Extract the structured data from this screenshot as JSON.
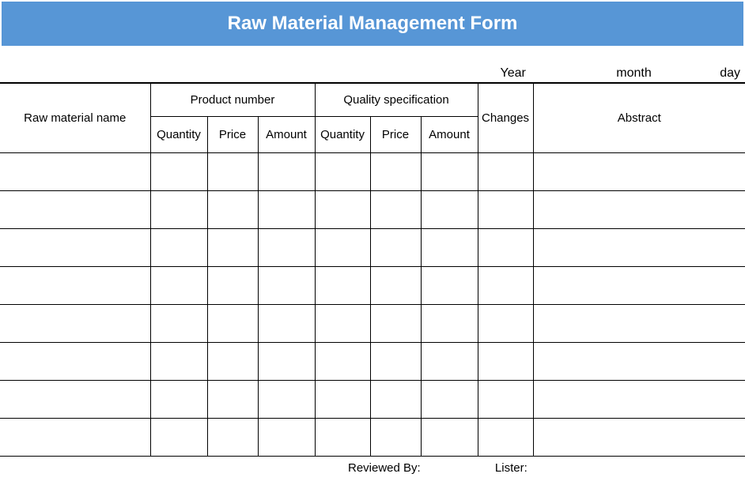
{
  "title": "Raw Material Management Form",
  "date": {
    "year_label": "Year",
    "month_label": "month",
    "day_label": "day"
  },
  "headers": {
    "raw_material_name": "Raw material name",
    "product_number": "Product number",
    "quality_specification": "Quality specification",
    "changes": "Changes",
    "abstract": "Abstract",
    "sub": {
      "quantity": "Quantity",
      "price": "Price",
      "amount": "Amount"
    }
  },
  "rows": [
    {
      "name": "",
      "p_qty": "",
      "p_price": "",
      "p_amt": "",
      "q_qty": "",
      "q_price": "",
      "q_amt": "",
      "changes": "",
      "abstract": ""
    },
    {
      "name": "",
      "p_qty": "",
      "p_price": "",
      "p_amt": "",
      "q_qty": "",
      "q_price": "",
      "q_amt": "",
      "changes": "",
      "abstract": ""
    },
    {
      "name": "",
      "p_qty": "",
      "p_price": "",
      "p_amt": "",
      "q_qty": "",
      "q_price": "",
      "q_amt": "",
      "changes": "",
      "abstract": ""
    },
    {
      "name": "",
      "p_qty": "",
      "p_price": "",
      "p_amt": "",
      "q_qty": "",
      "q_price": "",
      "q_amt": "",
      "changes": "",
      "abstract": ""
    },
    {
      "name": "",
      "p_qty": "",
      "p_price": "",
      "p_amt": "",
      "q_qty": "",
      "q_price": "",
      "q_amt": "",
      "changes": "",
      "abstract": ""
    },
    {
      "name": "",
      "p_qty": "",
      "p_price": "",
      "p_amt": "",
      "q_qty": "",
      "q_price": "",
      "q_amt": "",
      "changes": "",
      "abstract": ""
    },
    {
      "name": "",
      "p_qty": "",
      "p_price": "",
      "p_amt": "",
      "q_qty": "",
      "q_price": "",
      "q_amt": "",
      "changes": "",
      "abstract": ""
    },
    {
      "name": "",
      "p_qty": "",
      "p_price": "",
      "p_amt": "",
      "q_qty": "",
      "q_price": "",
      "q_amt": "",
      "changes": "",
      "abstract": ""
    }
  ],
  "footer": {
    "reviewed_by": "Reviewed By:",
    "lister": "Lister:"
  }
}
